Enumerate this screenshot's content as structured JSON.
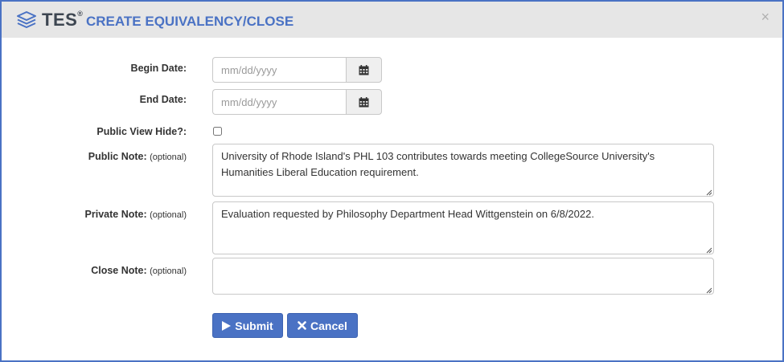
{
  "header": {
    "brand": "TES",
    "brand_mark": "®",
    "title": "CREATE EQUIVALENCY/CLOSE",
    "close_glyph": "×"
  },
  "form": {
    "begin_date": {
      "label": "Begin Date:",
      "placeholder": "mm/dd/yyyy",
      "value": ""
    },
    "end_date": {
      "label": "End Date:",
      "placeholder": "mm/dd/yyyy",
      "value": ""
    },
    "public_view_hide": {
      "label": "Public View Hide?:",
      "checked": false
    },
    "public_note": {
      "label": "Public Note:",
      "optional": "(optional)",
      "value": "University of Rhode Island's PHL 103 contributes towards meeting CollegeSource University's Humanities Liberal Education requirement."
    },
    "private_note": {
      "label": "Private Note:",
      "optional": "(optional)",
      "value": "Evaluation requested by Philosophy Department Head Wittgenstein on 6/8/2022."
    },
    "close_note": {
      "label": "Close Note:",
      "optional": "(optional)",
      "value": ""
    }
  },
  "buttons": {
    "submit_label": "Submit",
    "cancel_label": "Cancel"
  },
  "icons": {
    "logo": "stack-layers-icon",
    "calendar": "calendar-icon",
    "submit": "play-icon",
    "cancel": "times-icon",
    "close": "close-icon"
  },
  "colors": {
    "accent": "#4a72c4",
    "header_bg": "#e6e6e6",
    "brand_text": "#3d4651"
  }
}
